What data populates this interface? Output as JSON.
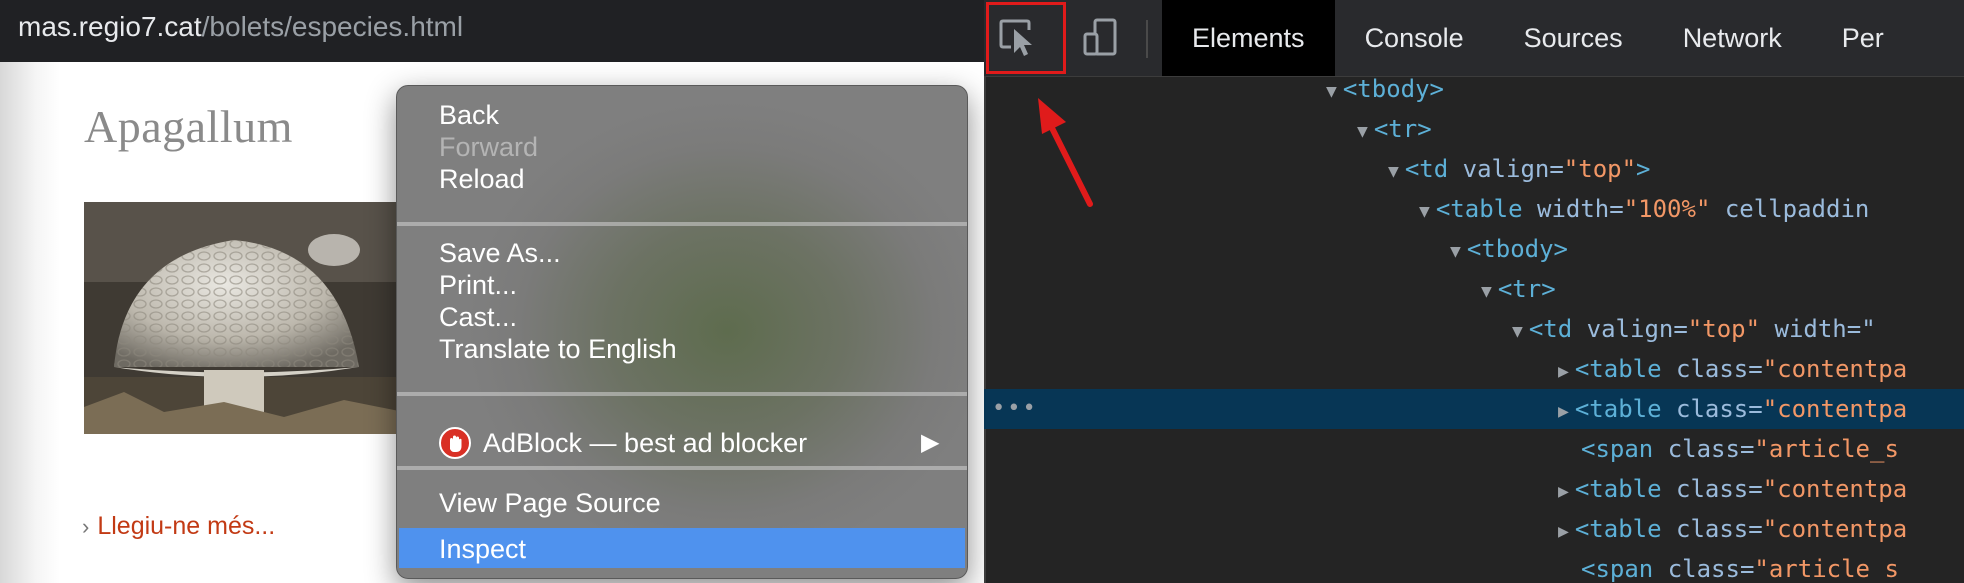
{
  "browser": {
    "url_host": "mas.regio7.cat",
    "url_path": "/bolets/especies.html",
    "article_title": "Apagallum",
    "read_more": "Llegiu-ne més..."
  },
  "context_menu": {
    "items": [
      {
        "label": "Back",
        "enabled": true
      },
      {
        "label": "Forward",
        "enabled": false
      },
      {
        "label": "Reload",
        "enabled": true
      },
      {
        "label": "Save As...",
        "enabled": true
      },
      {
        "label": "Print...",
        "enabled": true
      },
      {
        "label": "Cast...",
        "enabled": true
      },
      {
        "label": "Translate to English",
        "enabled": true
      },
      {
        "label": "AdBlock — best ad blocker",
        "enabled": true,
        "icon": "adblock-hand-icon",
        "submenu": true
      },
      {
        "label": "View Page Source",
        "enabled": true
      },
      {
        "label": "Inspect",
        "enabled": true,
        "highlighted": true
      }
    ]
  },
  "devtools": {
    "tabs": [
      "Elements",
      "Console",
      "Sources",
      "Network",
      "Per"
    ],
    "active_tab": "Elements",
    "tools": [
      "inspect-element-icon",
      "device-toolbar-icon"
    ],
    "highlight_color": "#e01b1b",
    "dom_tree": [
      {
        "tri": "▼",
        "tag": "<tbody>",
        "attrs": ""
      },
      {
        "tri": "▼",
        "tag": "<tr>",
        "attrs": ""
      },
      {
        "tri": "▼",
        "tag": "<td",
        "attr1": " valign=",
        "val1": "\"top\"",
        "close": ">"
      },
      {
        "tri": "▼",
        "tag": "<table",
        "attr1": " width=",
        "val1": "\"100%\"",
        "attr2": " cellpaddin"
      },
      {
        "tri": "▼",
        "tag": "<tbody>",
        "attrs": ""
      },
      {
        "tri": "▼",
        "tag": "<tr>",
        "attrs": ""
      },
      {
        "tri": "▼",
        "tag": "<td",
        "attr1": " valign=",
        "val1": "\"top\"",
        "attr2": " width=\""
      },
      {
        "tri": "▶",
        "tag": "<table",
        "attr1": " class=",
        "val1": "\"contentpa"
      },
      {
        "tri": "▶",
        "tag": "<table",
        "attr1": " class=",
        "val1": "\"contentpa",
        "selected": true
      },
      {
        "tri": "",
        "tag": "<span",
        "attr1": " class=",
        "val1": "\"article_s"
      },
      {
        "tri": "▶",
        "tag": "<table",
        "attr1": " class=",
        "val1": "\"contentpa"
      },
      {
        "tri": "▶",
        "tag": "<table",
        "attr1": " class=",
        "val1": "\"contentpa"
      },
      {
        "tri": "",
        "tag": "<span",
        "attr1": " class=",
        "val1": "\"article s"
      }
    ],
    "selected_dots": "•••"
  }
}
